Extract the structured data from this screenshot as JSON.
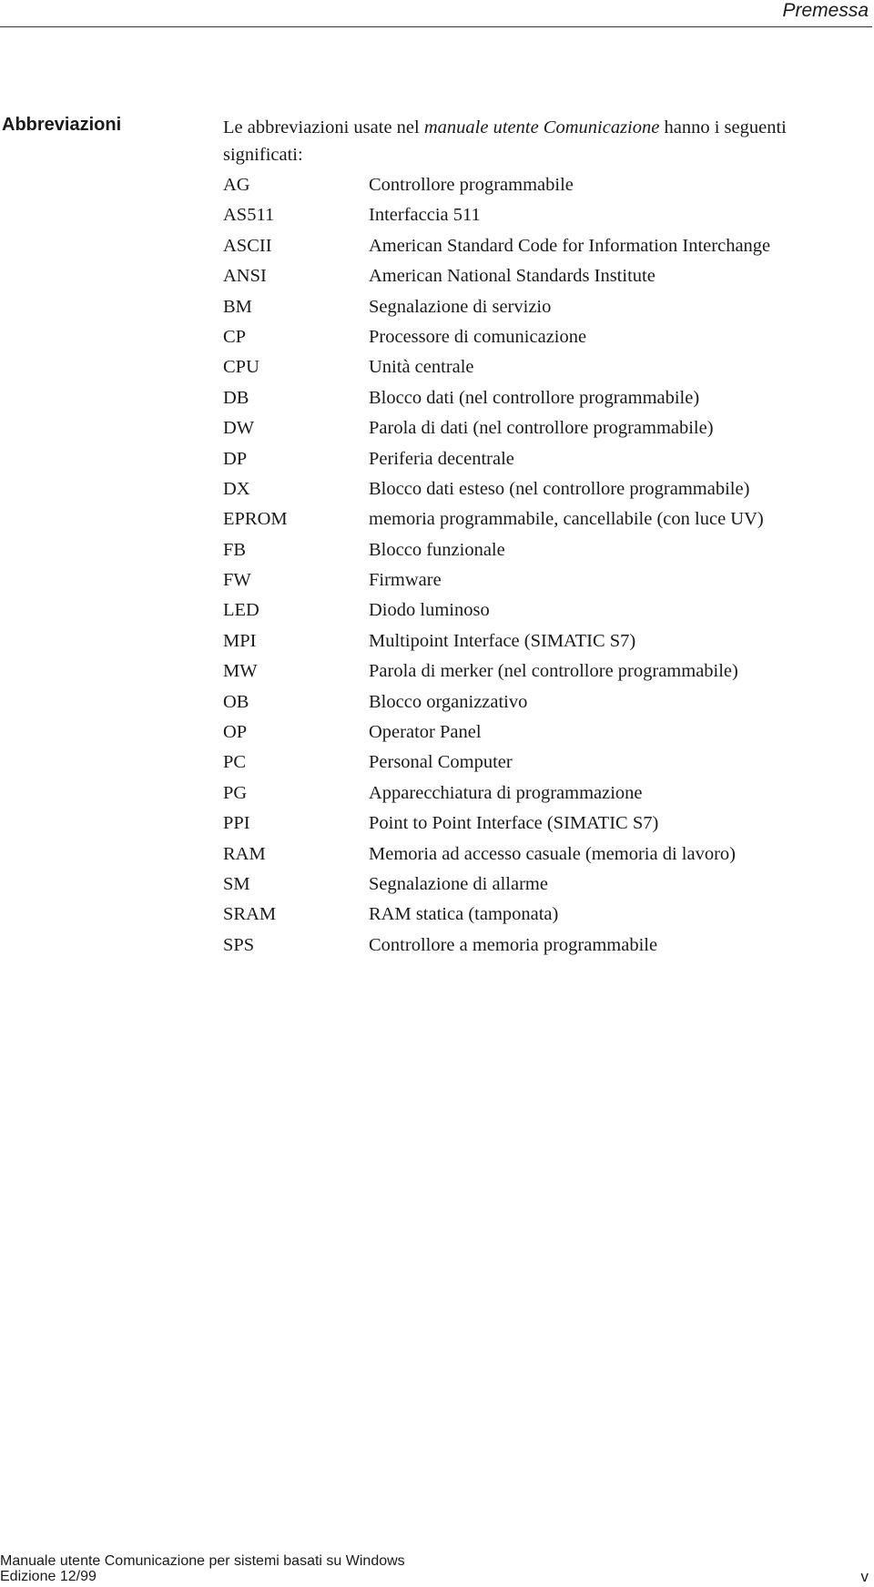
{
  "header": {
    "title": "Premessa"
  },
  "section": {
    "heading": "Abbreviazioni",
    "intro": {
      "before": "Le abbreviazioni usate nel ",
      "emphasis": "manuale utente Comunicazione",
      "after": " hanno i seguenti significati:"
    }
  },
  "abbreviations": [
    {
      "term": "AG",
      "definition": "Controllore programmabile"
    },
    {
      "term": "AS511",
      "definition": "Interfaccia 511"
    },
    {
      "term": "ASCII",
      "definition": "American Standard Code for Information Interchange"
    },
    {
      "term": "ANSI",
      "definition": "American National Standards Institute"
    },
    {
      "term": "BM",
      "definition": "Segnalazione di servizio"
    },
    {
      "term": "CP",
      "definition": "Processore di comunicazione"
    },
    {
      "term": "CPU",
      "definition": "Unità centrale"
    },
    {
      "term": "DB",
      "definition": "Blocco dati (nel controllore programmabile)"
    },
    {
      "term": "DW",
      "definition": "Parola di dati (nel controllore programmabile)"
    },
    {
      "term": "DP",
      "definition": "Periferia decentrale"
    },
    {
      "term": "DX",
      "definition": "Blocco dati esteso (nel controllore programmabile)"
    },
    {
      "term": "EPROM",
      "definition": "memoria programmabile, cancellabile (con luce UV)"
    },
    {
      "term": "FB",
      "definition": "Blocco funzionale"
    },
    {
      "term": "FW",
      "definition": "Firmware"
    },
    {
      "term": "LED",
      "definition": "Diodo luminoso"
    },
    {
      "term": "MPI",
      "definition": "Multipoint Interface (SIMATIC S7)"
    },
    {
      "term": "MW",
      "definition": "Parola di merker (nel controllore programmabile)"
    },
    {
      "term": "OB",
      "definition": "Blocco organizzativo"
    },
    {
      "term": "OP",
      "definition": "Operator Panel"
    },
    {
      "term": "PC",
      "definition": "Personal Computer"
    },
    {
      "term": "PG",
      "definition": "Apparecchiatura di programmazione"
    },
    {
      "term": "PPI",
      "definition": "Point to Point Interface (SIMATIC S7)"
    },
    {
      "term": "RAM",
      "definition": "Memoria ad accesso casuale (memoria di lavoro)"
    },
    {
      "term": "SM",
      "definition": "Segnalazione di allarme"
    },
    {
      "term": "SRAM",
      "definition": "RAM statica (tamponata)"
    },
    {
      "term": "SPS",
      "definition": "Controllore a memoria programmabile"
    }
  ],
  "footer": {
    "line1": "Manuale utente Comunicazione per sistemi basati su Windows",
    "line2": "Edizione 12/99",
    "page_number": "v"
  }
}
